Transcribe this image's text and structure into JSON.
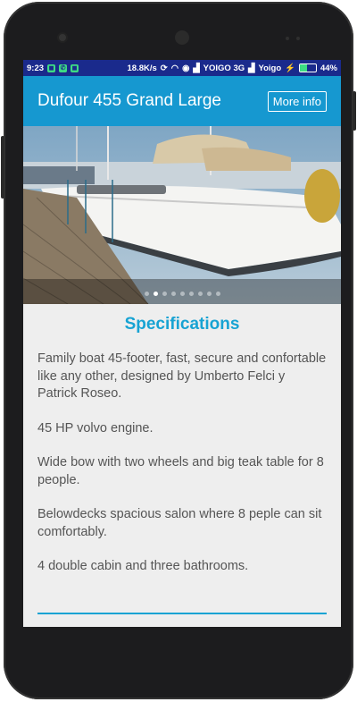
{
  "status_bar": {
    "time": "9:23",
    "speed": "18.8K/s",
    "carrier1": "YOIGO 3G",
    "carrier2": "Yoigo",
    "battery": "44%",
    "battery_level": 0.44
  },
  "app_bar": {
    "title": "Dufour 455 Grand Large",
    "more_info_label": "More info"
  },
  "carousel": {
    "image_alt": "Sailboat moored at a dock",
    "slide_count": 9,
    "active_index": 1
  },
  "specifications": {
    "heading": "Specifications",
    "paragraphs": [
      "Family boat 45-footer, fast, secure and confortable like any other, designed by Umberto Felci y Patrick Roseo.",
      "45 HP volvo engine.",
      "Wide bow with two wheels and big teak table for 8 people.",
      "Belowdecks spacious salon where 8 peple can sit comfortably.",
      "4 double cabin and three bathrooms."
    ]
  },
  "colors": {
    "app_bar": "#1698d0",
    "status_bar": "#1a2a8c",
    "accent": "#17a3d3",
    "background": "#eeeeee"
  }
}
